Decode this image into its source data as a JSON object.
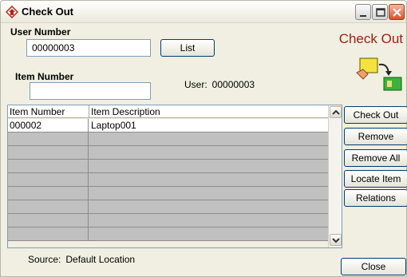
{
  "window": {
    "title": "Check Out",
    "icon": "checkout-app-icon"
  },
  "header": {
    "big_title": "Check Out"
  },
  "user_number": {
    "label": "User Number",
    "value": "00000003",
    "list_button": "List"
  },
  "item_number": {
    "label": "Item Number",
    "value": ""
  },
  "user_info": {
    "label": "User:",
    "value": "00000003"
  },
  "table": {
    "columns": [
      "Item Number",
      "Item Description"
    ],
    "rows": [
      {
        "item_number": "000002",
        "description": "Laptop001"
      }
    ]
  },
  "actions": {
    "check_out": "Check Out",
    "remove": "Remove",
    "remove_all": "Remove All",
    "locate_item": "Locate Item",
    "relations": "Relations"
  },
  "source": {
    "label": "Source:",
    "value": "Default Location"
  },
  "close_button": "Close",
  "colors": {
    "title_red": "#9b1f10",
    "grid_empty": "#c0c0c0"
  }
}
